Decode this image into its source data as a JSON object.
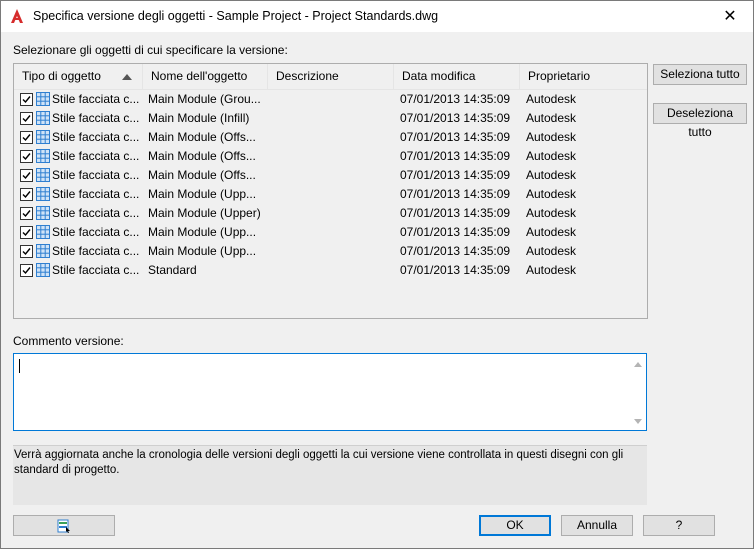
{
  "window": {
    "title": "Specifica versione degli oggetti - Sample Project - Project Standards.dwg",
    "close_glyph": "✕",
    "app_icon": "autocad-icon"
  },
  "list_label": "Selezionare gli oggetti di cui specificare la versione:",
  "columns": [
    "Tipo di oggetto",
    "Nome dell'oggetto",
    "Descrizione",
    "Data modifica",
    "Proprietario"
  ],
  "rows": [
    {
      "checked": true,
      "type": "Stile facciata c...",
      "name": "Main Module (Grou...",
      "desc": "",
      "date": "07/01/2013 14:35:09",
      "owner": "Autodesk"
    },
    {
      "checked": true,
      "type": "Stile facciata c...",
      "name": "Main Module (Infill)",
      "desc": "",
      "date": "07/01/2013 14:35:09",
      "owner": "Autodesk"
    },
    {
      "checked": true,
      "type": "Stile facciata c...",
      "name": "Main Module (Offs...",
      "desc": "",
      "date": "07/01/2013 14:35:09",
      "owner": "Autodesk"
    },
    {
      "checked": true,
      "type": "Stile facciata c...",
      "name": "Main Module (Offs...",
      "desc": "",
      "date": "07/01/2013 14:35:09",
      "owner": "Autodesk"
    },
    {
      "checked": true,
      "type": "Stile facciata c...",
      "name": "Main Module (Offs...",
      "desc": "",
      "date": "07/01/2013 14:35:09",
      "owner": "Autodesk"
    },
    {
      "checked": true,
      "type": "Stile facciata c...",
      "name": "Main Module (Upp...",
      "desc": "",
      "date": "07/01/2013 14:35:09",
      "owner": "Autodesk"
    },
    {
      "checked": true,
      "type": "Stile facciata c...",
      "name": "Main Module (Upper)",
      "desc": "",
      "date": "07/01/2013 14:35:09",
      "owner": "Autodesk"
    },
    {
      "checked": true,
      "type": "Stile facciata c...",
      "name": "Main Module (Upp...",
      "desc": "",
      "date": "07/01/2013 14:35:09",
      "owner": "Autodesk"
    },
    {
      "checked": true,
      "type": "Stile facciata c...",
      "name": "Main Module (Upp...",
      "desc": "",
      "date": "07/01/2013 14:35:09",
      "owner": "Autodesk"
    },
    {
      "checked": true,
      "type": "Stile facciata c...",
      "name": "Standard",
      "desc": "",
      "date": "07/01/2013 14:35:09",
      "owner": "Autodesk"
    }
  ],
  "buttons": {
    "select_all": "Seleziona tutto",
    "deselect_all": "Deseleziona tutto",
    "ok": "OK",
    "cancel": "Annulla",
    "help": "?"
  },
  "comment_label": "Commento versione:",
  "comment_value": "",
  "info_text": "Verrà aggiornata anche la cronologia delle versioni degli oggetti la cui versione viene controllata in questi disegni con gli standard di progetto.",
  "colors": {
    "accent": "#0078d7",
    "app_icon_red": "#d62c2c",
    "row_icon_blue": "#2f7fd0"
  }
}
